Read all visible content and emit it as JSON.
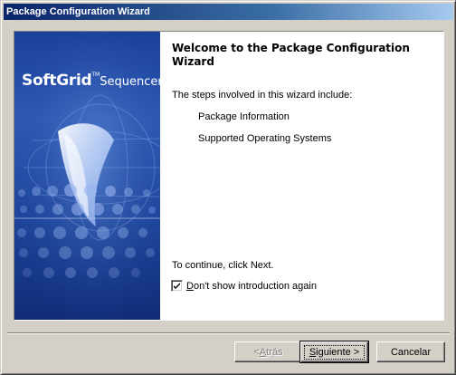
{
  "window": {
    "title": "Package Configuration Wizard"
  },
  "banner": {
    "logo_main": "SoftGrid",
    "logo_tm": "TM",
    "logo_sub": "Sequencer"
  },
  "main": {
    "heading": "Welcome to the Package Configuration Wizard",
    "intro": "The steps involved in this wizard include:",
    "steps": [
      {
        "label": "Package Information"
      },
      {
        "label": "Supported Operating Systems"
      }
    ],
    "continue_text": "To continue, click Next.",
    "checkbox": {
      "label_mnemonic": "D",
      "label_rest": "on't show introduction again",
      "checked": true
    }
  },
  "buttons": {
    "back_prefix": "< ",
    "back_mnemonic": "A",
    "back_rest": "trás",
    "next_mnemonic": "S",
    "next_rest": "iguiente >",
    "cancel_label": "Cancelar"
  }
}
